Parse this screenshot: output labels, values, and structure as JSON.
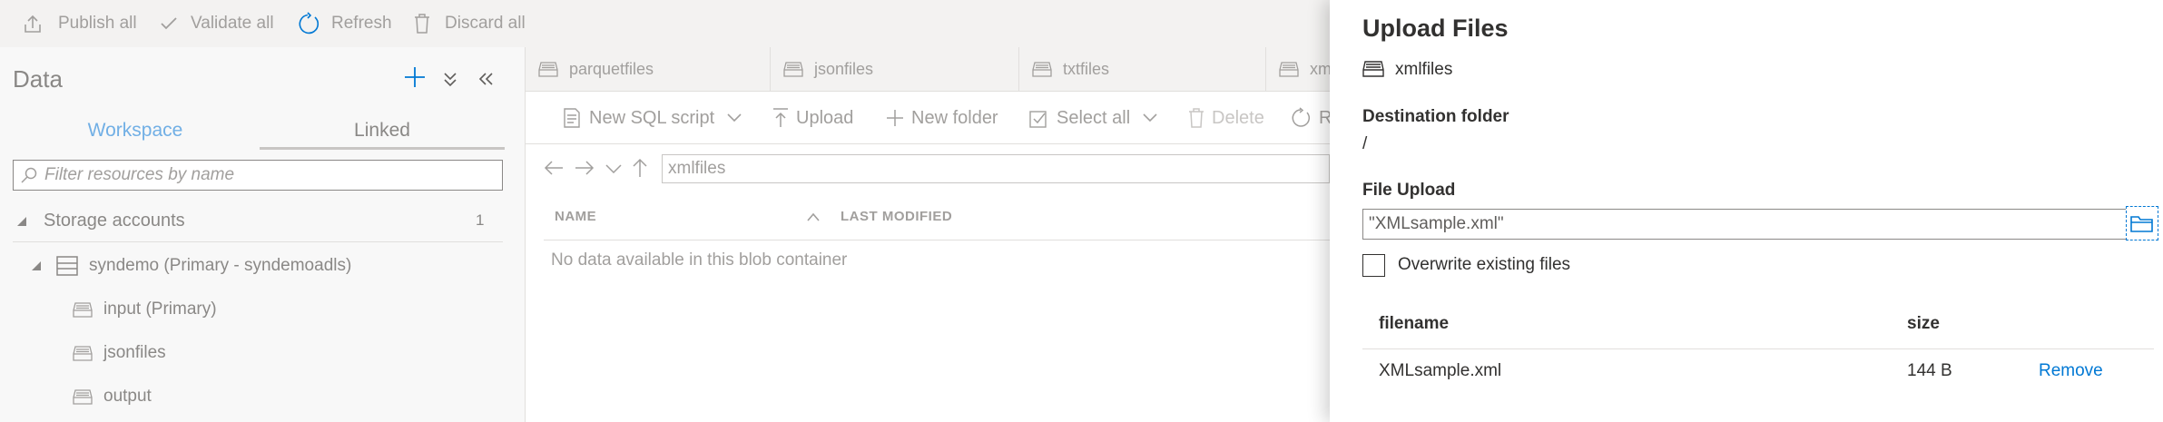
{
  "toolbar": {
    "publish_all": "Publish all",
    "validate_all": "Validate all",
    "refresh": "Refresh",
    "discard_all": "Discard all"
  },
  "data_panel": {
    "title": "Data",
    "tabs": {
      "workspace": "Workspace",
      "linked": "Linked"
    },
    "filter_placeholder": "Filter resources by name",
    "storage_accounts": {
      "label": "Storage accounts",
      "count": "1"
    },
    "account": "syndemo (Primary - syndemoadls)",
    "containers": [
      "input (Primary)",
      "jsonfiles",
      "output"
    ]
  },
  "center": {
    "tabs": [
      "parquetfiles",
      "jsonfiles",
      "txtfiles",
      "xm"
    ],
    "toolbar": {
      "new_sql_script": "New SQL script",
      "upload": "Upload",
      "new_folder": "New folder",
      "select_all": "Select all",
      "delete": "Delete",
      "refresh_partial": "R"
    },
    "breadcrumb": "xmlfiles",
    "columns": {
      "name": "NAME",
      "last_modified": "LAST MODIFIED"
    },
    "empty_message": "No data available in this blob container"
  },
  "upload_panel": {
    "title": "Upload Files",
    "container": "xmlfiles",
    "destination_label": "Destination folder",
    "destination_value": "/",
    "file_upload_label": "File Upload",
    "file_value": "\"XMLsample.xml\"",
    "overwrite_label": "Overwrite existing files",
    "overwrite_checked": false,
    "table_headers": {
      "filename": "filename",
      "size": "size"
    },
    "files": [
      {
        "filename": "XMLsample.xml",
        "size": "144 B",
        "action": "Remove"
      }
    ]
  },
  "colors": {
    "accent": "#0078d4",
    "disabled_text": "#a19f9d",
    "toolbar_bg": "#f3f2f1"
  }
}
